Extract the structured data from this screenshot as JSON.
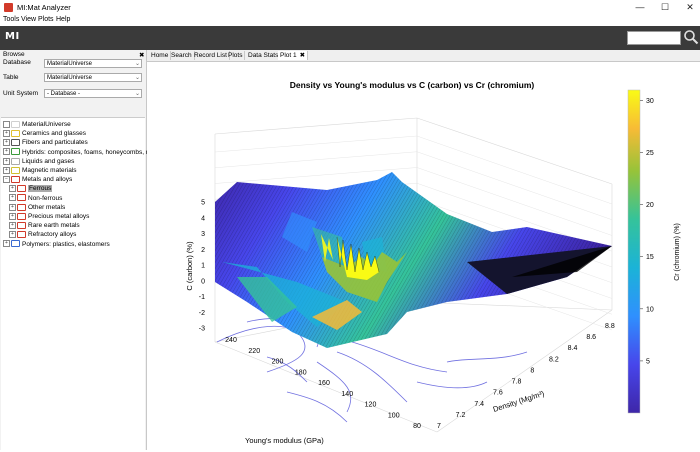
{
  "window": {
    "title": "MI:Mat Analyzer",
    "controls": [
      "—",
      "☐",
      "✕"
    ]
  },
  "menu": [
    "Tools",
    "View",
    "Plots",
    "Help"
  ],
  "header": {
    "logo": "MI",
    "search_value": ""
  },
  "left_panel": {
    "browse_label": "Browse",
    "close_glyph": "✖",
    "database_label": "Database",
    "database_value": "MaterialUniverse",
    "table_label": "Table",
    "table_value": "MaterialUniverse",
    "unit_system_label": "Unit System",
    "unit_system_value": "- Database -",
    "tree": [
      {
        "label": "MaterialUniverse",
        "level": 0,
        "expander": "",
        "folder": "#d0d0d0"
      },
      {
        "label": "Ceramics and glasses",
        "level": 0,
        "expander": "+",
        "folder": "#e0c030"
      },
      {
        "label": "Fibers and particulates",
        "level": 0,
        "expander": "+",
        "folder": "#555555"
      },
      {
        "label": "Hybrids: composites, foams, honeycombs, natural",
        "level": 0,
        "expander": "+",
        "folder": "#3a9a3a"
      },
      {
        "label": "Liquids and gases",
        "level": 0,
        "expander": "+",
        "folder": "#aaaaaa"
      },
      {
        "label": "Magnetic materials",
        "level": 0,
        "expander": "+",
        "folder": "#d0c030"
      },
      {
        "label": "Metals and alloys",
        "level": 0,
        "expander": "−",
        "folder": "#d03a2a"
      },
      {
        "label": "Ferrous",
        "level": 1,
        "expander": "+",
        "folder": "#d03a2a",
        "selected": true
      },
      {
        "label": "Non-ferrous",
        "level": 1,
        "expander": "+",
        "folder": "#d03a2a"
      },
      {
        "label": "Other metals",
        "level": 1,
        "expander": "+",
        "folder": "#d03a2a"
      },
      {
        "label": "Precious metal alloys",
        "level": 1,
        "expander": "+",
        "folder": "#d03a2a"
      },
      {
        "label": "Rare earth metals",
        "level": 1,
        "expander": "+",
        "folder": "#d03a2a"
      },
      {
        "label": "Refractory alloys",
        "level": 1,
        "expander": "+",
        "folder": "#d03a2a"
      },
      {
        "label": "Polymers: plastics, elastomers",
        "level": 0,
        "expander": "+",
        "folder": "#3a6ad0"
      }
    ]
  },
  "tabs": [
    "Home",
    "Search",
    "Record List",
    "Plots",
    "Data Stats",
    "Plot 1"
  ],
  "active_tab": 5,
  "tab_close_glyph": "✖",
  "chart_data": {
    "type": "surface",
    "title": "Density vs Young's modulus vs C (carbon) vs Cr (chromium)",
    "xlabel": "Young's modulus (GPa)",
    "ylabel": "Density (Mg/m³)",
    "zlabel": "C (carbon) (%)",
    "colorbar_label": "Cr (chromium) (%)",
    "x_ticks": [
      240,
      220,
      200,
      180,
      160,
      140,
      120,
      100,
      80
    ],
    "y_ticks": [
      7,
      7.2,
      7.4,
      7.6,
      7.8,
      8,
      8.2,
      8.4,
      8.6,
      8.8
    ],
    "z_ticks": [
      5,
      4,
      3,
      2,
      1,
      0,
      -1,
      -2,
      -3
    ],
    "colorbar_ticks": [
      30,
      25,
      20,
      15,
      10,
      5
    ],
    "colorbar_range": [
      0,
      31
    ],
    "colormap": [
      "#3e26a8",
      "#4746eb",
      "#2f90fe",
      "#1bb3d7",
      "#35c39a",
      "#97c339",
      "#f7bb36",
      "#f9fb15"
    ],
    "grid": true
  }
}
